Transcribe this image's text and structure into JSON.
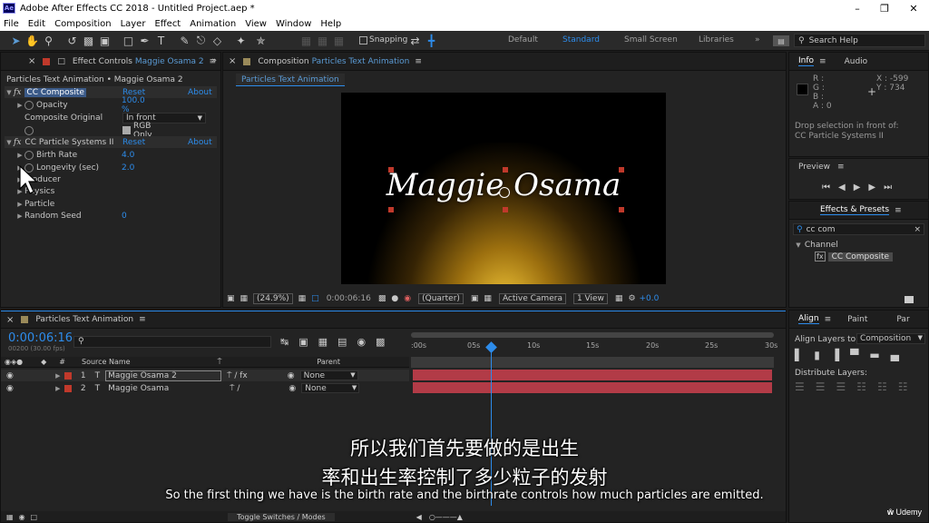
{
  "window": {
    "title": "Adobe After Effects CC 2018 - Untitled Project.aep *",
    "logo": "Ae"
  },
  "menu": [
    "File",
    "Edit",
    "Composition",
    "Layer",
    "Effect",
    "Animation",
    "View",
    "Window",
    "Help"
  ],
  "toolbar": {
    "snapping": "Snapping",
    "workspaces": [
      "Default",
      "Standard",
      "Small Screen",
      "Libraries"
    ],
    "active_workspace": "Standard",
    "search_help": "Search Help"
  },
  "effect_controls": {
    "tab_prefix": "Effect Controls",
    "tab_layer": "Maggie Osama 2",
    "breadcrumb": "Particles Text Animation • Maggie Osama 2",
    "effects": [
      {
        "name": "CC Composite",
        "reset": "Reset",
        "about": "About"
      },
      {
        "name": "CC Particle Systems II",
        "reset": "Reset",
        "about": "About"
      }
    ],
    "opacity_label": "Opacity",
    "opacity_value": "100.0 %",
    "composite_original_label": "Composite Original",
    "composite_original_value": "In front",
    "rgb_only": "RGB Only",
    "birth_rate_label": "Birth Rate",
    "birth_rate_value": "4.0",
    "longevity_label": "Longevity (sec)",
    "longevity_value": "2.0",
    "producer_label": "Producer",
    "physics_label": "Physics",
    "particle_label": "Particle",
    "random_seed_label": "Random Seed",
    "random_seed_value": "0"
  },
  "composition": {
    "tab_prefix": "Composition",
    "tab_name": "Particles Text Animation",
    "subtab": "Particles Text Animation",
    "text": "Maggie Osama",
    "zoom": "(24.9%)",
    "timecode": "0:00:06:16",
    "resolution": "(Quarter)",
    "camera": "Active Camera",
    "views": "1 View",
    "exposure": "+0.0"
  },
  "info": {
    "tab": "Info",
    "audio_tab": "Audio",
    "r": "R :",
    "g": "G :",
    "b": "B :",
    "a": "A : 0",
    "x": "X : -599",
    "y": "Y : 734",
    "drop_text_1": "Drop selection in front of:",
    "drop_text_2": "CC Particle Systems II"
  },
  "preview": {
    "tab": "Preview"
  },
  "effects_presets": {
    "tab": "Effects & Presets",
    "search": "cc com",
    "category": "Channel",
    "result": "CC Composite"
  },
  "timeline": {
    "tab": "Particles Text Animation",
    "timecode": "0:00:06:16",
    "frames": "00200 (30.00 fps)",
    "col_source": "Source Name",
    "col_parent": "Parent",
    "ruler": [
      ":00s",
      "05s",
      "10s",
      "15s",
      "20s",
      "25s",
      "30s"
    ],
    "layers": [
      {
        "num": "1",
        "name": "Maggie Osama 2",
        "parent": "None"
      },
      {
        "num": "2",
        "name": "Maggie Osama",
        "parent": "None"
      }
    ],
    "toggle": "Toggle Switches / Modes"
  },
  "align": {
    "tab": "Align",
    "paint_tab": "Paint",
    "par_tab": "Par",
    "align_to_label": "Align Layers to:",
    "align_to_value": "Composition",
    "distribute": "Distribute Layers:"
  },
  "subtitles": {
    "zh1": "所以我们首先要做的是出生",
    "zh2": "率和出生率控制了多少粒子的发射",
    "en": "So the first thing we have is the birth rate and the birthrate controls how much particles are emitted."
  },
  "watermark": "Udemy"
}
